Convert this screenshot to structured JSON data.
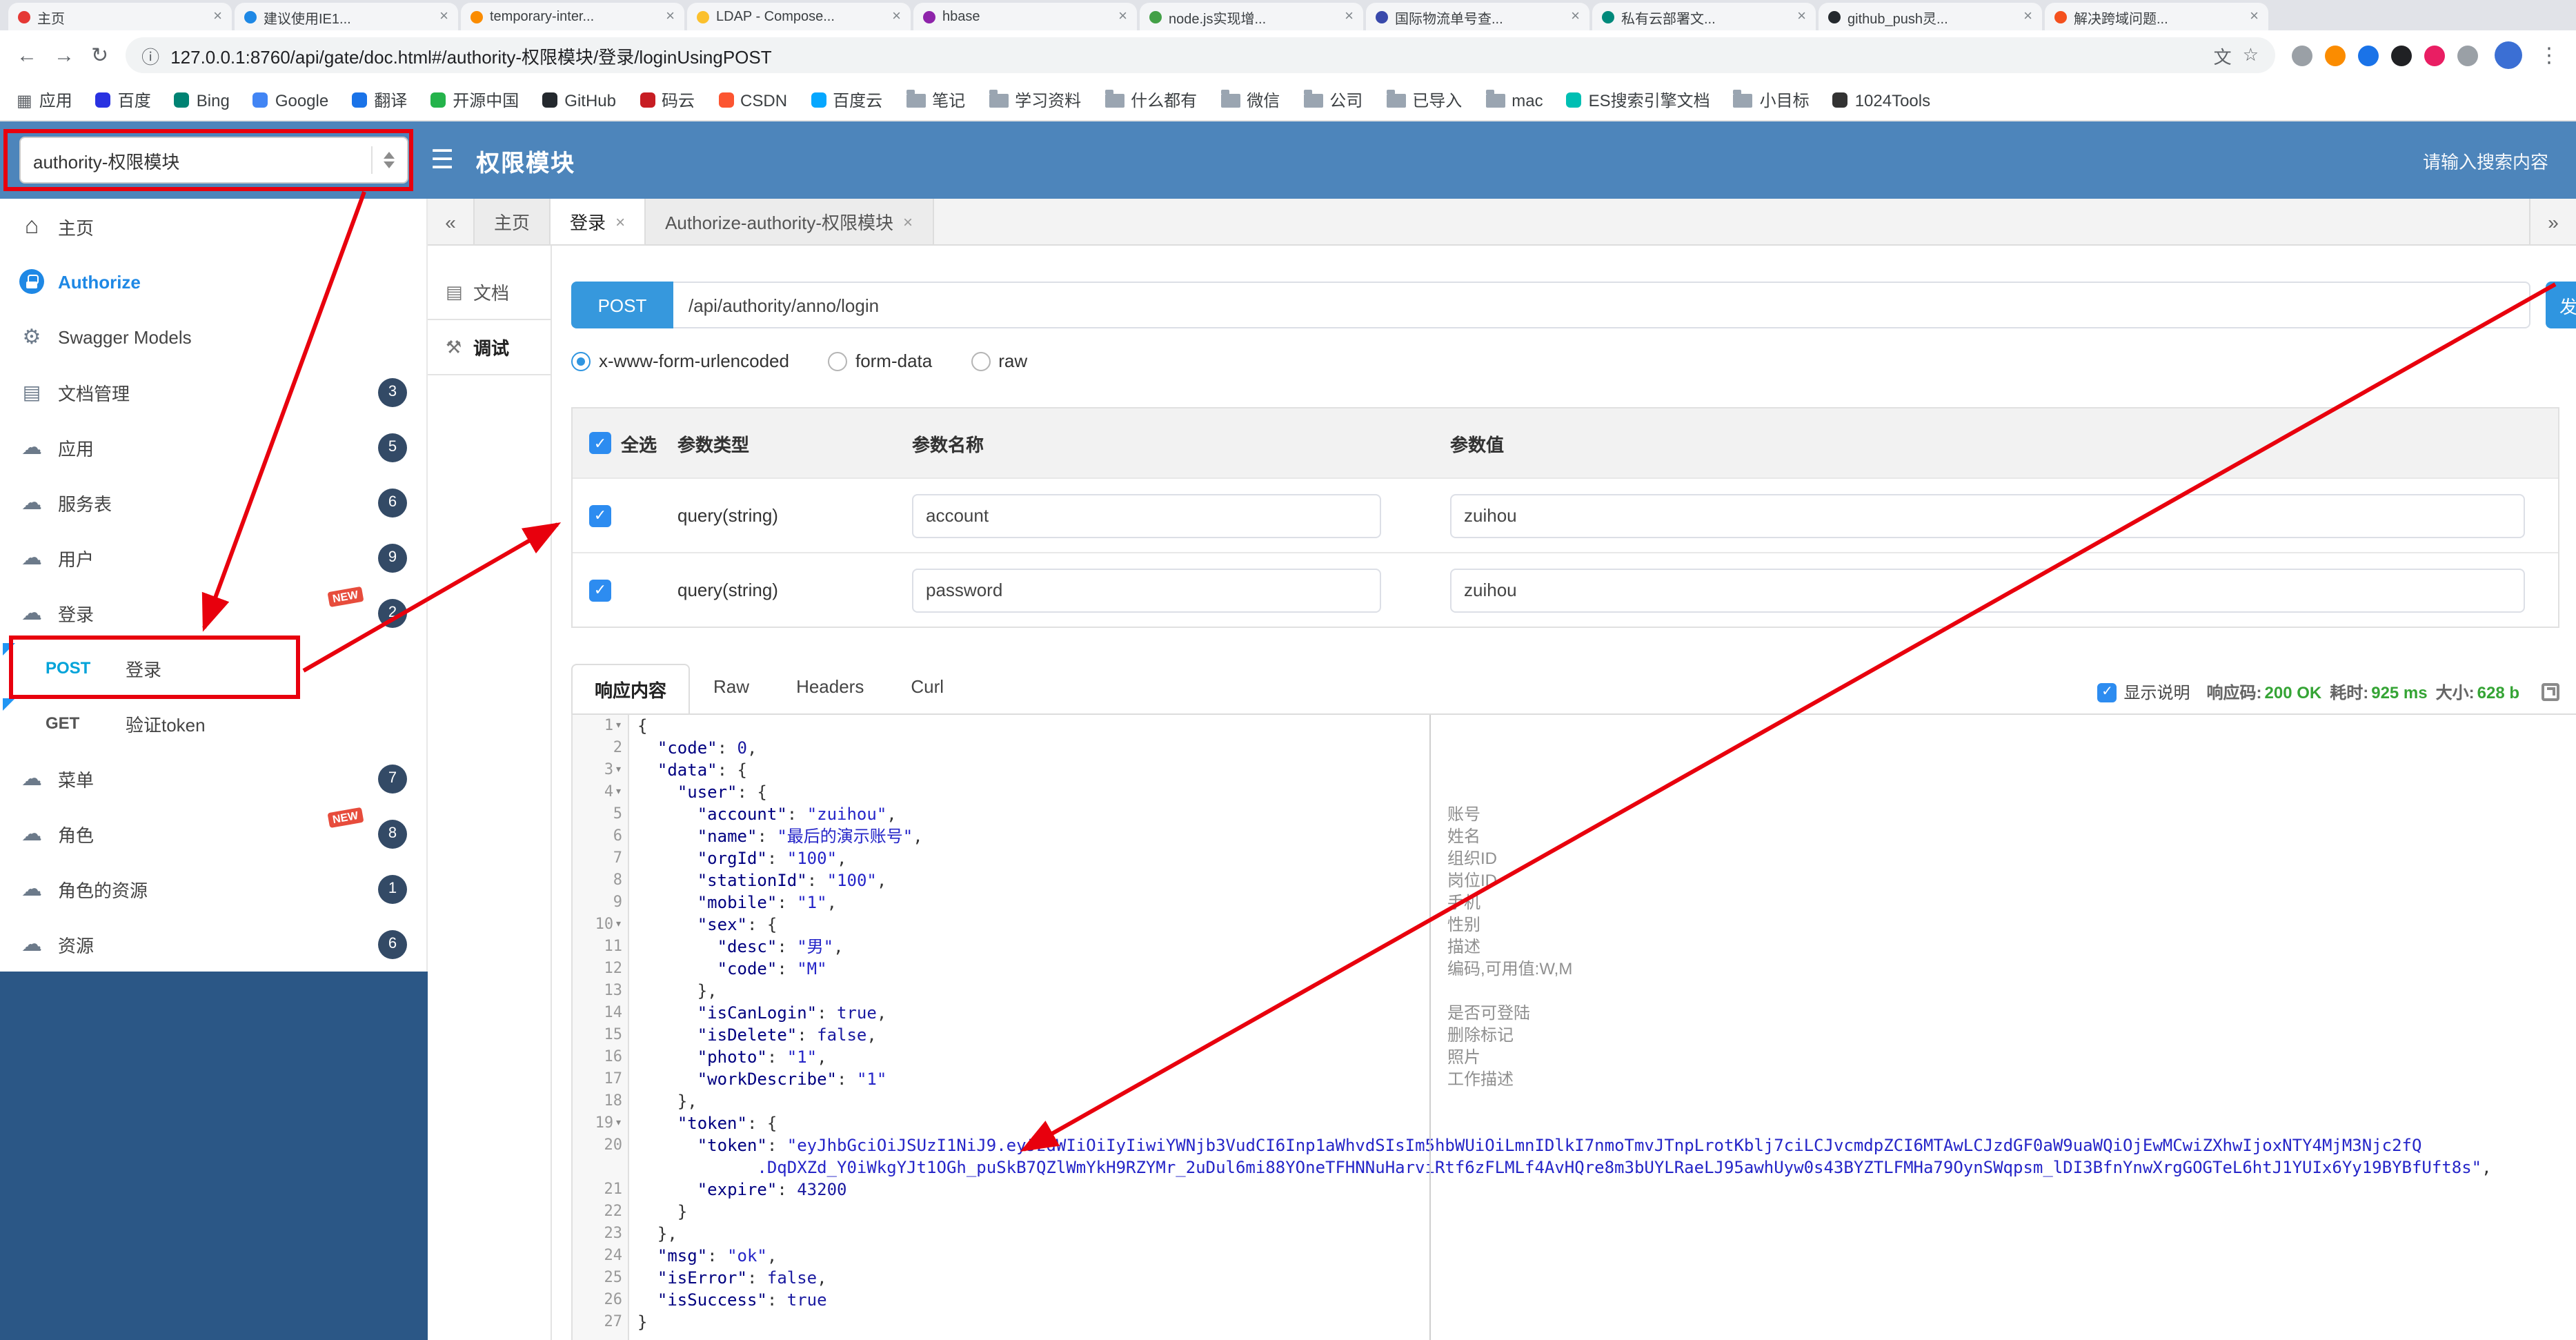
{
  "colors": {
    "header": "#4d85bb",
    "sidebar_dark": "#2b5786",
    "primary": "#2f95e0",
    "annotation": "#e8000d",
    "success": "#35a435",
    "method_post": "#00a3d9"
  },
  "icons": {
    "close": "×",
    "back_arrow": "←",
    "forward_arrow": "→",
    "reload": "↻",
    "info": "ⓘ",
    "translate": "文",
    "star": "☆",
    "kebab": "⋮",
    "menu": "☰",
    "fold": "▾",
    "tab_back": "«",
    "tab_forward": "»"
  },
  "browser": {
    "url": "127.0.0.1:8760/api/gate/doc.html#/authority-权限模块/登录/loginUsingPOST",
    "tabs": [
      {
        "title": "主页",
        "color": "#e53935"
      },
      {
        "title": "建议使用IE1...",
        "color": "#1e88e5"
      },
      {
        "title": "temporary-inter...",
        "color": "#fb8c00"
      },
      {
        "title": "LDAP - Compose...",
        "color": "#fbc02d"
      },
      {
        "title": "hbase",
        "color": "#8e24aa"
      },
      {
        "title": "node.js实现增...",
        "color": "#43a047"
      },
      {
        "title": "国际物流单号查...",
        "color": "#3949ab"
      },
      {
        "title": "私有云部署文...",
        "color": "#00897b"
      },
      {
        "title": "github_push灵...",
        "color": "#24292e"
      },
      {
        "title": "解决跨域问题...",
        "color": "#f4511e"
      }
    ],
    "extensions": [
      {
        "color": "#9aa0a6"
      },
      {
        "color": "#fb8c00"
      },
      {
        "color": "#1a73e8"
      },
      {
        "color": "#202124"
      },
      {
        "color": "#e91e63"
      },
      {
        "color": "#9aa0a6"
      }
    ],
    "bookmarks": [
      {
        "label": "应用",
        "icon": "grid"
      },
      {
        "label": "百度",
        "icon": "dot",
        "color": "#2932e1"
      },
      {
        "label": "Bing",
        "icon": "dot",
        "color": "#008373"
      },
      {
        "label": "Google",
        "icon": "dot",
        "color": "#4285f4"
      },
      {
        "label": "翻译",
        "icon": "dot",
        "color": "#1a73e8"
      },
      {
        "label": "开源中国",
        "icon": "dot",
        "color": "#24b34b"
      },
      {
        "label": "GitHub",
        "icon": "dot",
        "color": "#24292e"
      },
      {
        "label": "码云",
        "icon": "dot",
        "color": "#c71d23"
      },
      {
        "label": "CSDN",
        "icon": "dot",
        "color": "#fc5531"
      },
      {
        "label": "百度云",
        "icon": "dot",
        "color": "#06a7ff"
      },
      {
        "label": "笔记",
        "icon": "folder"
      },
      {
        "label": "学习资料",
        "icon": "folder"
      },
      {
        "label": "什么都有",
        "icon": "folder"
      },
      {
        "label": "微信",
        "icon": "folder"
      },
      {
        "label": "公司",
        "icon": "folder"
      },
      {
        "label": "已导入",
        "icon": "folder"
      },
      {
        "label": "mac",
        "icon": "folder"
      },
      {
        "label": "ES搜索引擎文档",
        "icon": "dot",
        "color": "#00bfb3"
      },
      {
        "label": "小目标",
        "icon": "folder"
      },
      {
        "label": "1024Tools",
        "icon": "dot",
        "color": "#333333"
      }
    ]
  },
  "header": {
    "module_select": "authority-权限模块",
    "title": "权限模块",
    "search_placeholder": "请输入搜索内容"
  },
  "sidebar": {
    "new_label": "NEW",
    "items": [
      {
        "label": "主页",
        "icon": "home",
        "kind": "item"
      },
      {
        "label": "Authorize",
        "icon": "lock",
        "kind": "item",
        "accent": true
      },
      {
        "label": "Swagger Models",
        "icon": "gear",
        "kind": "item"
      },
      {
        "label": "文档管理",
        "icon": "doc",
        "kind": "item",
        "badge": "3"
      },
      {
        "label": "应用",
        "icon": "cloud",
        "kind": "item",
        "badge": "5"
      },
      {
        "label": "服务表",
        "icon": "cloud",
        "kind": "item",
        "badge": "6"
      },
      {
        "label": "用户",
        "icon": "cloud",
        "kind": "item",
        "badge": "9"
      },
      {
        "label": "登录",
        "icon": "cloud",
        "kind": "item",
        "badge": "2",
        "new": true
      },
      {
        "label": "登录",
        "method": "POST",
        "kind": "sub"
      },
      {
        "label": "验证token",
        "method": "GET",
        "kind": "sub"
      },
      {
        "label": "菜单",
        "icon": "cloud",
        "kind": "item",
        "badge": "7"
      },
      {
        "label": "角色",
        "icon": "cloud",
        "kind": "item",
        "badge": "8",
        "new": true
      },
      {
        "label": "角色的资源",
        "icon": "cloud",
        "kind": "item",
        "badge": "1"
      },
      {
        "label": "资源",
        "icon": "cloud",
        "kind": "item",
        "badge": "6"
      }
    ]
  },
  "main": {
    "tabs": [
      {
        "label": "主页"
      },
      {
        "label": "登录",
        "closable": true,
        "active": true
      },
      {
        "label": "Authorize-authority-权限模块",
        "closable": true
      }
    ],
    "side_tabs": [
      {
        "label": "文档",
        "icon": "doc"
      },
      {
        "label": "调试",
        "icon": "debug",
        "active": true
      }
    ]
  },
  "request": {
    "method": "POST",
    "path": "/api/authority/anno/login",
    "send_label": "发",
    "content_types": [
      {
        "label": "x-www-form-urlencoded",
        "selected": true
      },
      {
        "label": "form-data"
      },
      {
        "label": "raw"
      }
    ],
    "params_table": {
      "select_all_label": "全选",
      "select_all_checked": true,
      "headers": [
        "参数类型",
        "参数名称",
        "参数值"
      ],
      "rows": [
        {
          "checked": true,
          "type": "query(string)",
          "name": "account",
          "value": "zuihou"
        },
        {
          "checked": true,
          "type": "query(string)",
          "name": "password",
          "value": "zuihou"
        }
      ]
    }
  },
  "response": {
    "tabs": [
      {
        "label": "响应内容",
        "active": true
      },
      {
        "label": "Raw"
      },
      {
        "label": "Headers"
      },
      {
        "label": "Curl"
      }
    ],
    "show_desc_label": "显示说明",
    "show_desc_checked": true,
    "meta": [
      {
        "label": "响应码:",
        "value": "200 OK"
      },
      {
        "label": "耗时:",
        "value": "925 ms"
      },
      {
        "label": "大小:",
        "value": "628 b"
      }
    ],
    "notes": [
      "账号",
      "姓名",
      "组织ID",
      "岗位ID",
      "手机",
      "性别",
      "描述",
      "编码,可用值:W,M",
      "",
      "是否可登陆",
      "删除标记",
      "照片",
      "工作描述"
    ],
    "lines": [
      {
        "n": 1,
        "fold": true,
        "seg": [
          [
            "p",
            "{"
          ]
        ]
      },
      {
        "n": 2,
        "seg": [
          [
            "p",
            "  "
          ],
          [
            "k",
            "\"code\""
          ],
          [
            "p",
            ": "
          ],
          [
            "n",
            "0"
          ],
          [
            "p",
            ","
          ]
        ]
      },
      {
        "n": 3,
        "fold": true,
        "seg": [
          [
            "p",
            "  "
          ],
          [
            "k",
            "\"data\""
          ],
          [
            "p",
            ": {"
          ]
        ]
      },
      {
        "n": 4,
        "fold": true,
        "seg": [
          [
            "p",
            "    "
          ],
          [
            "k",
            "\"user\""
          ],
          [
            "p",
            ": {"
          ]
        ]
      },
      {
        "n": 5,
        "seg": [
          [
            "p",
            "      "
          ],
          [
            "k",
            "\"account\""
          ],
          [
            "p",
            ": "
          ],
          [
            "s",
            "\"zuihou\""
          ],
          [
            "p",
            ","
          ]
        ]
      },
      {
        "n": 6,
        "seg": [
          [
            "p",
            "      "
          ],
          [
            "k",
            "\"name\""
          ],
          [
            "p",
            ": "
          ],
          [
            "s",
            "\"最后的演示账号\""
          ],
          [
            "p",
            ","
          ]
        ]
      },
      {
        "n": 7,
        "seg": [
          [
            "p",
            "      "
          ],
          [
            "k",
            "\"orgId\""
          ],
          [
            "p",
            ": "
          ],
          [
            "s",
            "\"100\""
          ],
          [
            "p",
            ","
          ]
        ]
      },
      {
        "n": 8,
        "seg": [
          [
            "p",
            "      "
          ],
          [
            "k",
            "\"stationId\""
          ],
          [
            "p",
            ": "
          ],
          [
            "s",
            "\"100\""
          ],
          [
            "p",
            ","
          ]
        ]
      },
      {
        "n": 9,
        "seg": [
          [
            "p",
            "      "
          ],
          [
            "k",
            "\"mobile\""
          ],
          [
            "p",
            ": "
          ],
          [
            "s",
            "\"1\""
          ],
          [
            "p",
            ","
          ]
        ]
      },
      {
        "n": 10,
        "fold": true,
        "seg": [
          [
            "p",
            "      "
          ],
          [
            "k",
            "\"sex\""
          ],
          [
            "p",
            ": {"
          ]
        ]
      },
      {
        "n": 11,
        "seg": [
          [
            "p",
            "        "
          ],
          [
            "k",
            "\"desc\""
          ],
          [
            "p",
            ": "
          ],
          [
            "s",
            "\"男\""
          ],
          [
            "p",
            ","
          ]
        ]
      },
      {
        "n": 12,
        "seg": [
          [
            "p",
            "        "
          ],
          [
            "k",
            "\"code\""
          ],
          [
            "p",
            ": "
          ],
          [
            "s",
            "\"M\""
          ]
        ]
      },
      {
        "n": 13,
        "seg": [
          [
            "p",
            "      },"
          ]
        ]
      },
      {
        "n": 14,
        "seg": [
          [
            "p",
            "      "
          ],
          [
            "k",
            "\"isCanLogin\""
          ],
          [
            "p",
            ": "
          ],
          [
            "b",
            "true"
          ],
          [
            "p",
            ","
          ]
        ]
      },
      {
        "n": 15,
        "seg": [
          [
            "p",
            "      "
          ],
          [
            "k",
            "\"isDelete\""
          ],
          [
            "p",
            ": "
          ],
          [
            "b",
            "false"
          ],
          [
            "p",
            ","
          ]
        ]
      },
      {
        "n": 16,
        "seg": [
          [
            "p",
            "      "
          ],
          [
            "k",
            "\"photo\""
          ],
          [
            "p",
            ": "
          ],
          [
            "s",
            "\"1\""
          ],
          [
            "p",
            ","
          ]
        ]
      },
      {
        "n": 17,
        "seg": [
          [
            "p",
            "      "
          ],
          [
            "k",
            "\"workDescribe\""
          ],
          [
            "p",
            ": "
          ],
          [
            "s",
            "\"1\""
          ]
        ]
      },
      {
        "n": 18,
        "seg": [
          [
            "p",
            "    },"
          ]
        ]
      },
      {
        "n": 19,
        "fold": true,
        "seg": [
          [
            "p",
            "    "
          ],
          [
            "k",
            "\"token\""
          ],
          [
            "p",
            ": {"
          ]
        ]
      },
      {
        "n": 20,
        "seg": [
          [
            "p",
            "      "
          ],
          [
            "k",
            "\"token\""
          ],
          [
            "p",
            ": "
          ],
          [
            "s",
            "\"eyJhbGciOiJSUzI1NiJ9.eyJzdWIiOiIyIiwiYWNjb3VudCI6Inp1aWhvdSIsIm5hbWUiOiLmnIDlkI7nmoTmvJTnpLrotKblj7ciLCJvcmdpZCI6MTAwLCJzdGF0aW9uaWQiOjEwMCwiZXhwIjoxNTY4MjM3Njc2fQ\n            .DqDXZd_Y0iWkgYJt1OGh_puSkB7QZlWmYkH9RZYMr_2uDul6mi88YOneTFHNNuHarviRtf6zFLMLf4AvHQre8m3bUYLRaeLJ95awhUyw0s43BYZTLFMHa79OynSWqpsm_lDI3BfnYnwXrgGOGTeL6htJ1YUIx6Yy19BYBfUft8s\""
          ],
          [
            "p",
            ","
          ]
        ]
      },
      {
        "n": 21,
        "seg": [
          [
            "p",
            "      "
          ],
          [
            "k",
            "\"expire\""
          ],
          [
            "p",
            ": "
          ],
          [
            "n",
            "43200"
          ]
        ]
      },
      {
        "n": 22,
        "seg": [
          [
            "p",
            "    }"
          ]
        ]
      },
      {
        "n": 23,
        "seg": [
          [
            "p",
            "  },"
          ]
        ]
      },
      {
        "n": 24,
        "seg": [
          [
            "p",
            "  "
          ],
          [
            "k",
            "\"msg\""
          ],
          [
            "p",
            ": "
          ],
          [
            "s",
            "\"ok\""
          ],
          [
            "p",
            ","
          ]
        ]
      },
      {
        "n": 25,
        "seg": [
          [
            "p",
            "  "
          ],
          [
            "k",
            "\"isError\""
          ],
          [
            "p",
            ": "
          ],
          [
            "b",
            "false"
          ],
          [
            "p",
            ","
          ]
        ]
      },
      {
        "n": 26,
        "seg": [
          [
            "p",
            "  "
          ],
          [
            "k",
            "\"isSuccess\""
          ],
          [
            "p",
            ": "
          ],
          [
            "b",
            "true"
          ]
        ]
      },
      {
        "n": 27,
        "seg": [
          [
            "p",
            "}"
          ]
        ]
      }
    ]
  }
}
